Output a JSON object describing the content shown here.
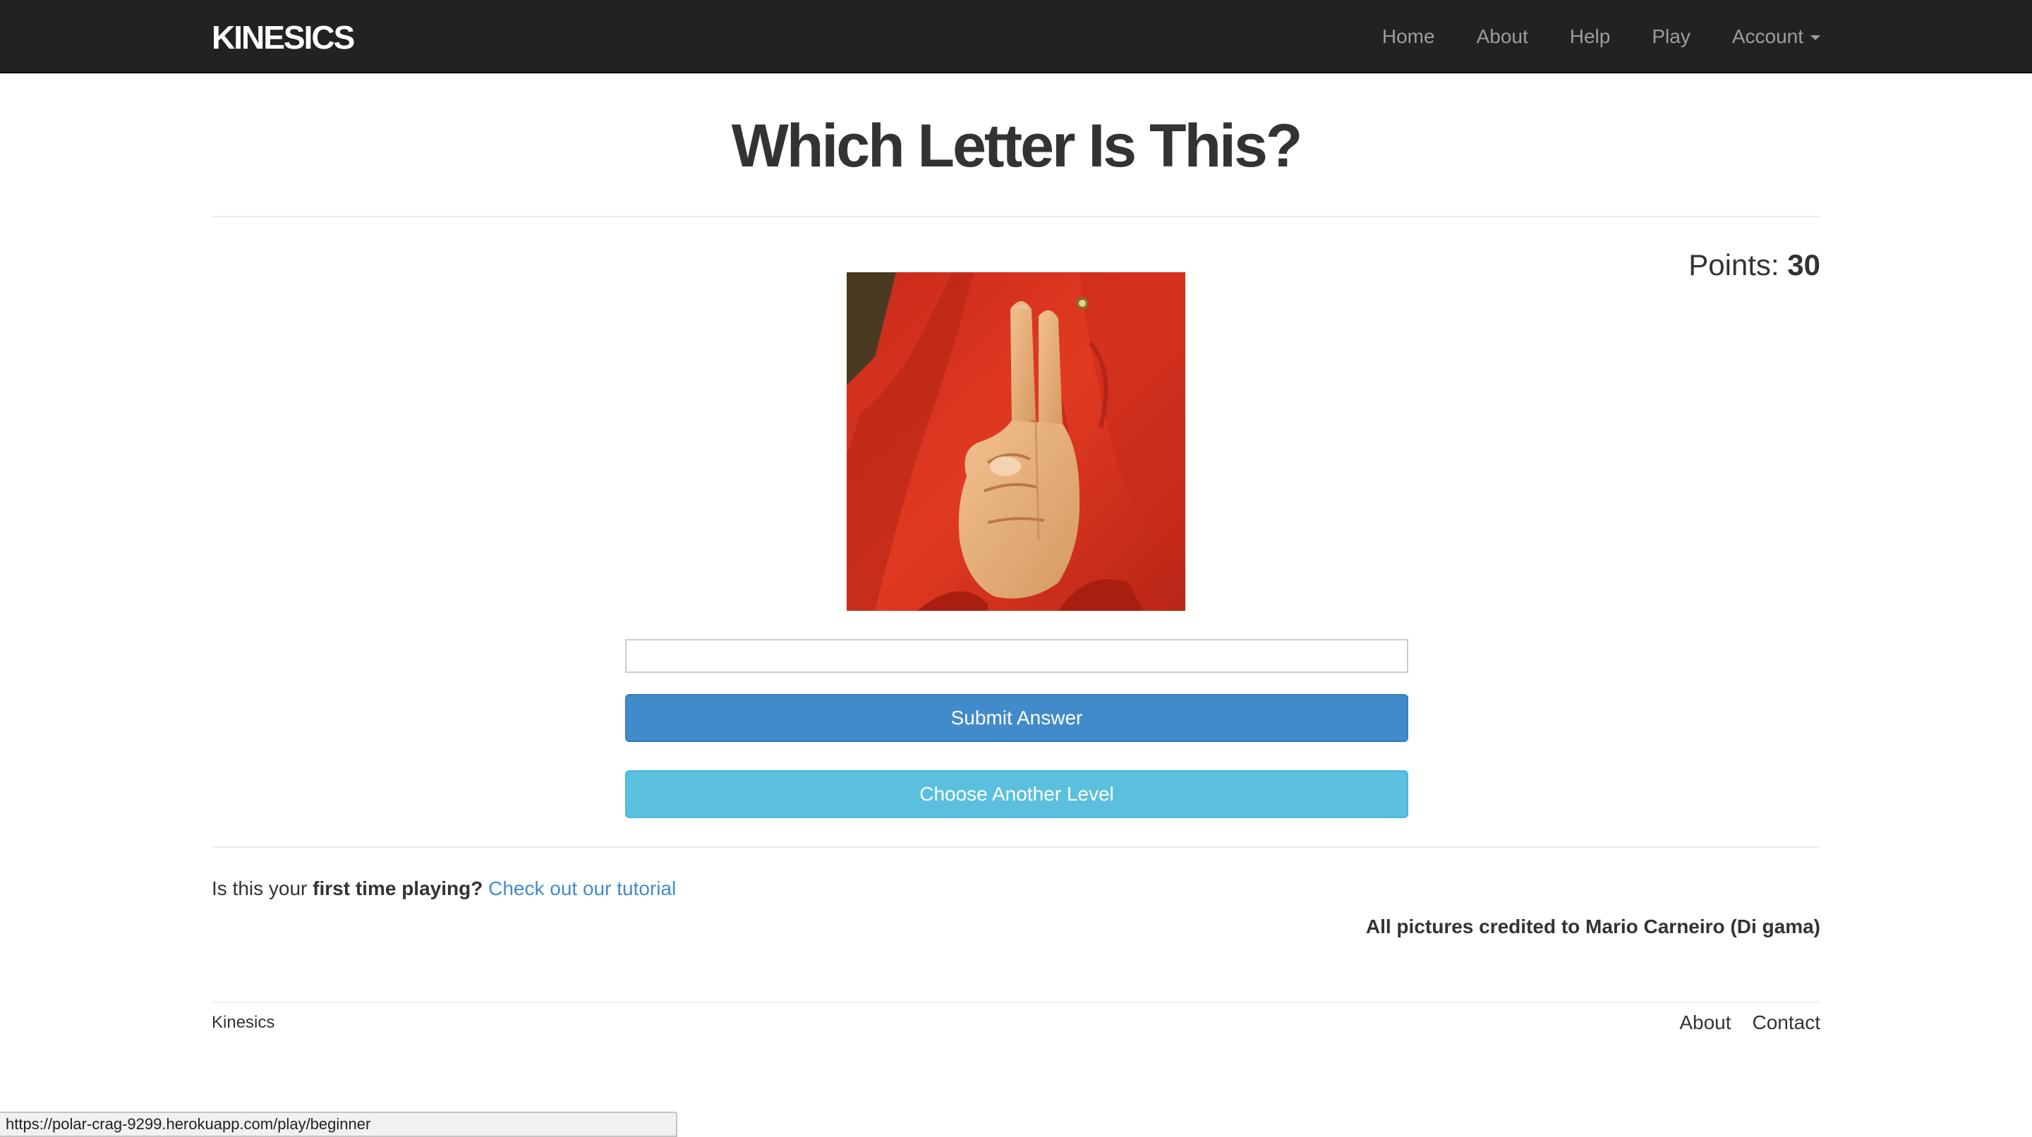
{
  "navbar": {
    "brand": "KINESICS",
    "items": [
      {
        "label": "Home"
      },
      {
        "label": "About"
      },
      {
        "label": "Help"
      },
      {
        "label": "Play"
      },
      {
        "label": "Account"
      }
    ]
  },
  "main": {
    "title": "Which Letter Is This?",
    "points_label": "Points:",
    "points_value": "30",
    "image_alt": "hand-sign-letter",
    "answer_value": "",
    "submit_label": "Submit Answer",
    "choose_level_label": "Choose Another Level"
  },
  "help": {
    "prefix": "Is this your ",
    "bold": "first time playing?",
    "link": "Check out our tutorial"
  },
  "credit": "All pictures credited to Mario Carneiro (Di gama)",
  "footer": {
    "brand": "Kinesics",
    "links": [
      {
        "label": "About"
      },
      {
        "label": "Contact"
      }
    ]
  },
  "status_bar": {
    "url": "https://polar-crag-9299.herokuapp.com/play/beginner"
  },
  "colors": {
    "navbar_bg": "#222222",
    "primary": "#428bca",
    "info": "#5bc0de",
    "shirt_red": "#d9341f"
  }
}
